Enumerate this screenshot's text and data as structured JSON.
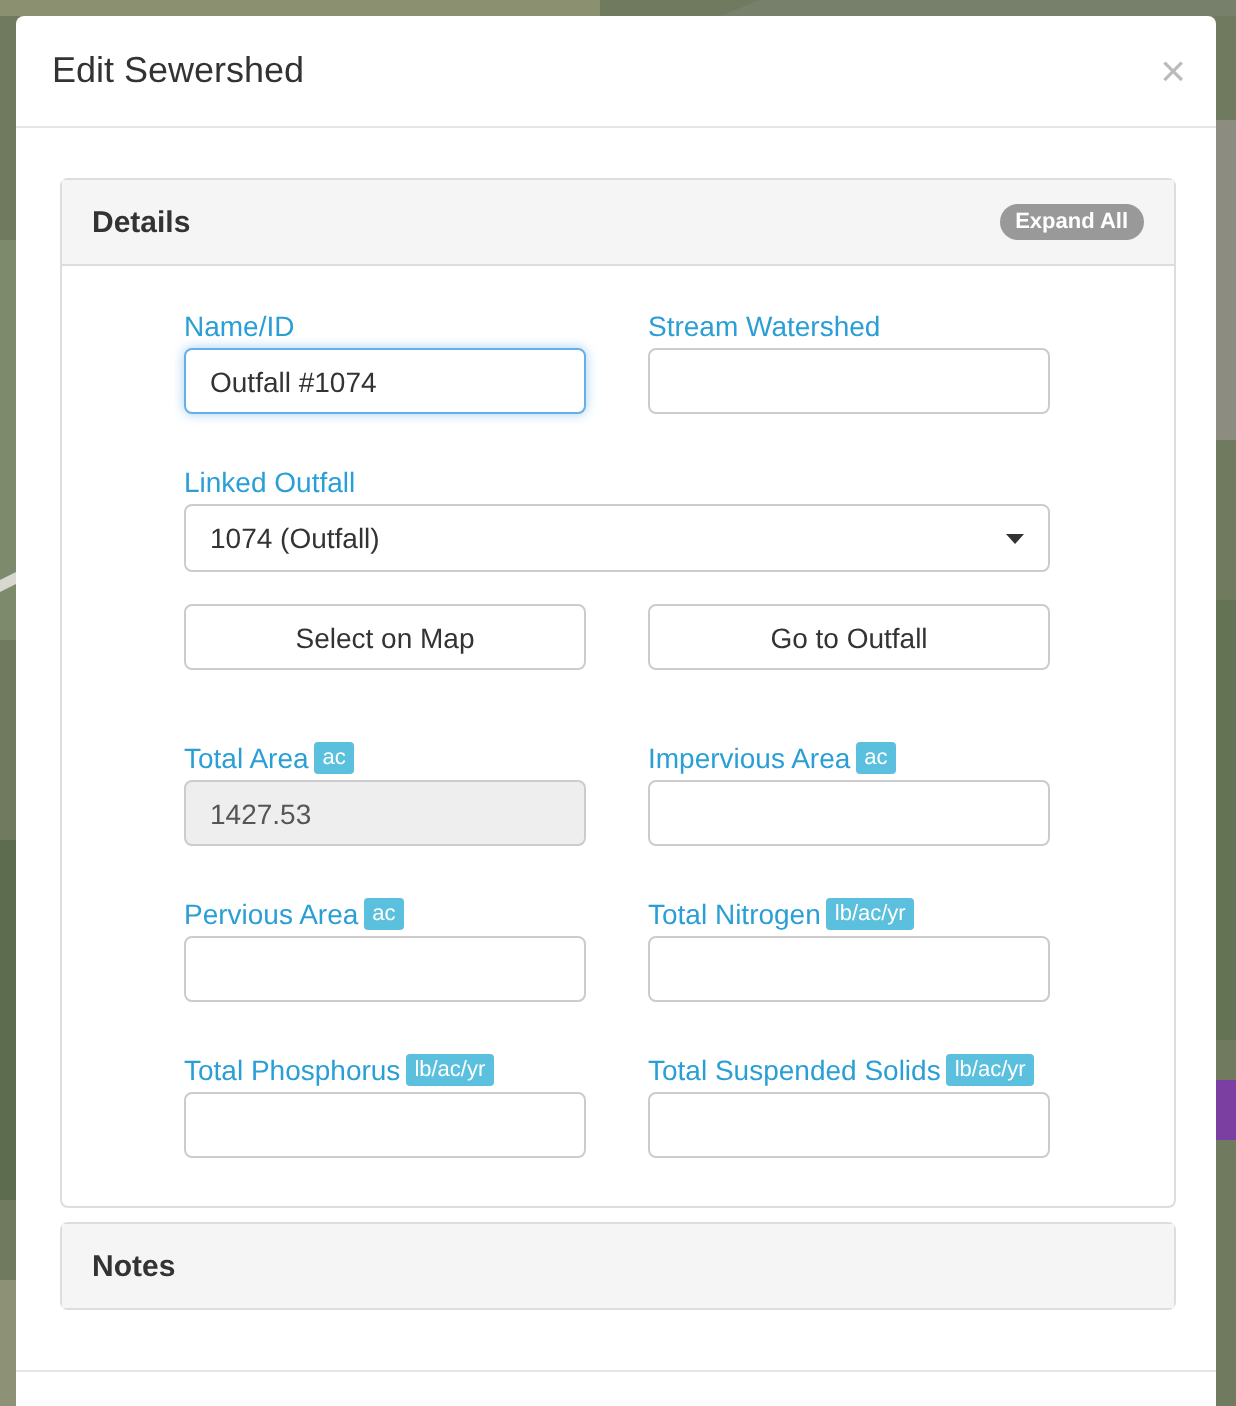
{
  "modal": {
    "title": "Edit Sewershed",
    "close": "×"
  },
  "panels": [
    {
      "title": "Details",
      "badge": "Expand All",
      "rows": [
        {
          "items": [
            {
              "kind": "input",
              "label": "Name/ID",
              "value": "Outfall #1074",
              "focused": true,
              "disabled": false
            },
            {
              "kind": "input",
              "label": "Stream Watershed",
              "focused": false,
              "disabled": false
            }
          ]
        },
        {
          "items": [
            {
              "kind": "select",
              "label": "Linked Outfall",
              "value": "1074 (Outfall)"
            }
          ]
        },
        {
          "items": [
            {
              "kind": "button",
              "text": "Select on Map"
            },
            {
              "kind": "button",
              "text": "Go to Outfall"
            }
          ]
        },
        {
          "items": [
            {
              "kind": "input",
              "label": "Total Area",
              "unit": "ac",
              "value": "1427.53",
              "focused": false,
              "disabled": true
            },
            {
              "kind": "input",
              "label": "Impervious Area",
              "unit": "ac",
              "focused": false,
              "disabled": false
            }
          ]
        },
        {
          "items": [
            {
              "kind": "input",
              "label": "Pervious Area",
              "unit": "ac",
              "focused": false,
              "disabled": false
            },
            {
              "kind": "input",
              "label": "Total Nitrogen",
              "unit": "lb/ac/yr",
              "focused": false,
              "disabled": false
            }
          ]
        },
        {
          "items": [
            {
              "kind": "input",
              "label": "Total Phosphorus",
              "unit": "lb/ac/yr",
              "focused": false,
              "disabled": false
            },
            {
              "kind": "input",
              "label": "Total Suspended Solids",
              "unit": "lb/ac/yr",
              "focused": false,
              "disabled": false
            }
          ]
        }
      ]
    },
    {
      "title": "Notes"
    }
  ]
}
